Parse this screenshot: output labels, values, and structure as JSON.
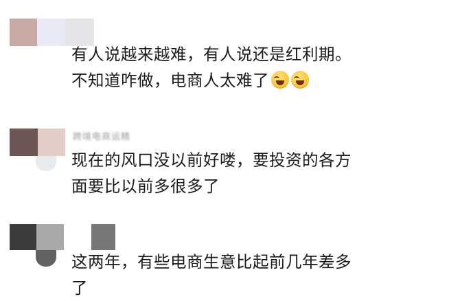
{
  "comments": [
    {
      "username": "",
      "text_lines": [
        "有人说越来越难，有人说还是红利期。",
        "不知道咋做，电商人太难了"
      ],
      "emoji": "rolling-on-floor-laughing",
      "avatar_colors": [
        "#c9a9a6",
        "#e9e9f5",
        "#e6e6e8"
      ]
    },
    {
      "username": "跨境电商运精",
      "text_lines": [
        "现在的风口没以前好喽，要投资的各方",
        "面要比以前多很多了"
      ],
      "avatar_colors": [
        "#6f5656",
        "#e3cdc9"
      ]
    },
    {
      "username": "",
      "text_lines": [
        "这两年，有些电商生意比起前几年差多",
        "了"
      ],
      "avatar_colors": [
        "#3b3b3b",
        "#a9a9a7",
        "#ffffff",
        "#777777"
      ]
    }
  ]
}
